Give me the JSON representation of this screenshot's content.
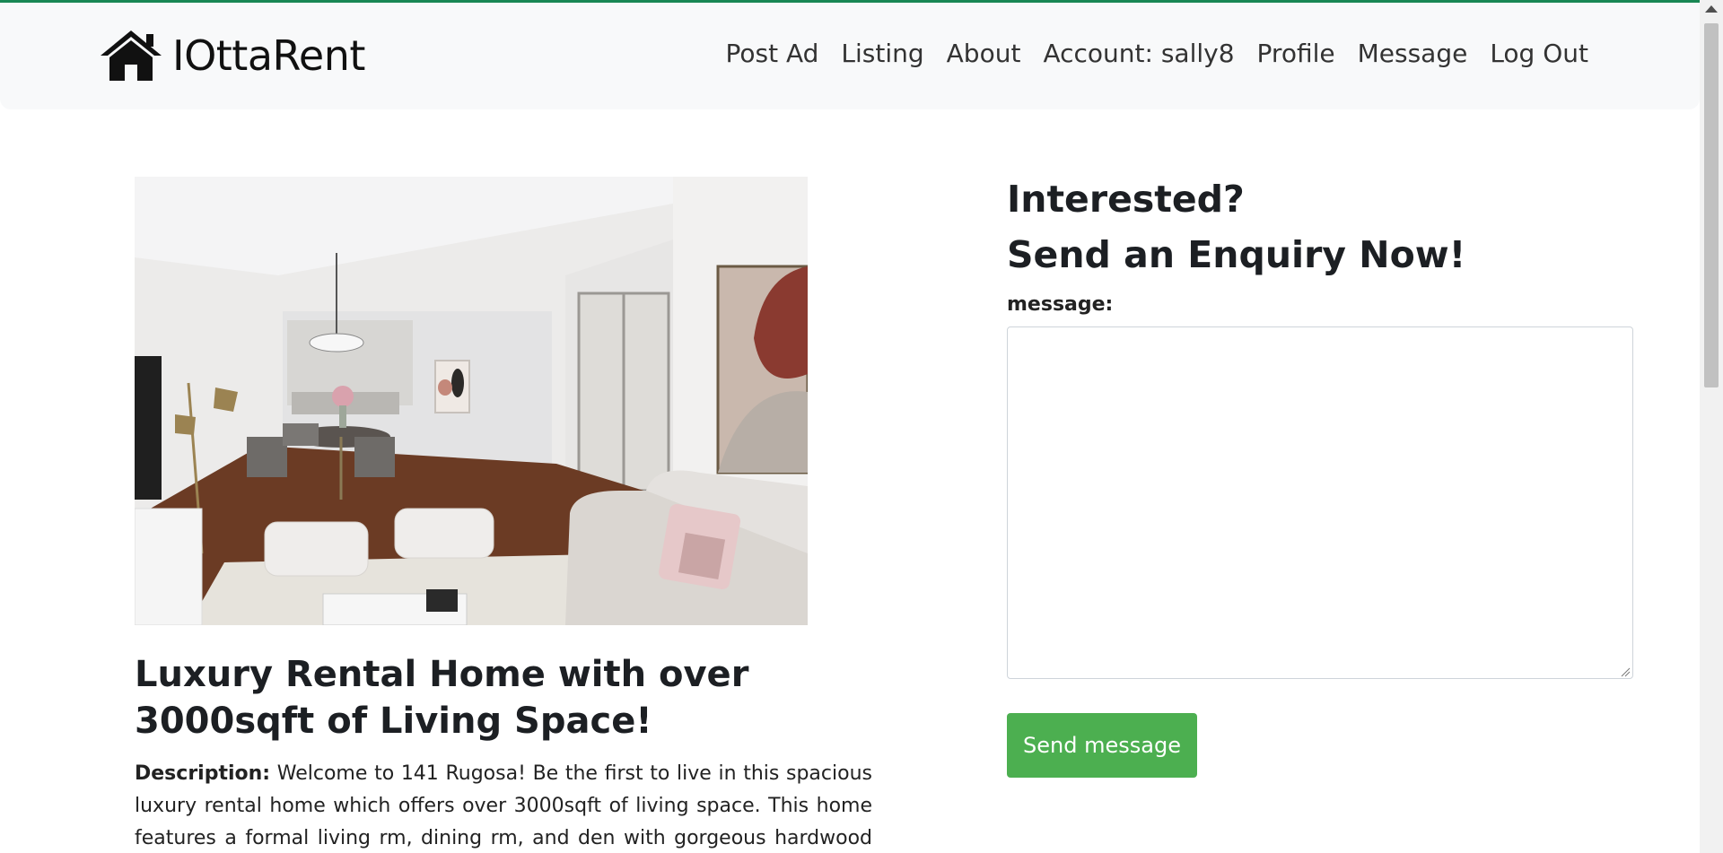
{
  "navbar": {
    "brand": "IOttaRent",
    "brand_icon": "house-icon",
    "links": [
      "Post Ad",
      "Listing",
      "About",
      "Account: sally8",
      "Profile",
      "Message",
      "Log Out"
    ]
  },
  "listing": {
    "photo_alt": "living-room-photo",
    "title": "Luxury Rental Home with over 3000sqft of Living Space!",
    "description_label": "Description:",
    "description_text": "Welcome to 141 Rugosa! Be the first to live in this spacious luxury rental home which offers over 3000sqft of living space. This home features a formal living rm, dining rm, and den with gorgeous hardwood flrs"
  },
  "enquiry": {
    "heading_line1": "Interested?",
    "heading_line2": "Send an Enquiry Now!",
    "message_label": "message:",
    "message_value": "",
    "send_button": "Send message"
  },
  "colors": {
    "accent_line": "#198754",
    "send_button": "#4caf50",
    "navbar_bg": "#f8f9fa"
  }
}
